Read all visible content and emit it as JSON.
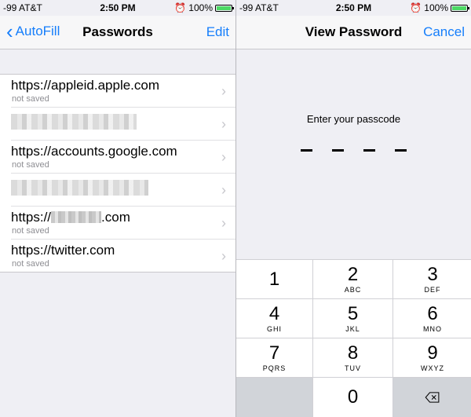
{
  "left": {
    "status": {
      "carrier": "-99 AT&T",
      "time": "2:50 PM",
      "battery": "100%"
    },
    "nav": {
      "back_label": "AutoFill",
      "title": "Passwords",
      "edit_label": "Edit"
    },
    "rows": [
      {
        "title": "https://appleid.apple.com",
        "subtitle": "not saved"
      },
      {
        "title": "",
        "subtitle": ""
      },
      {
        "title": "https://accounts.google.com",
        "subtitle": "not saved"
      },
      {
        "title": "",
        "subtitle": ""
      },
      {
        "title_prefix": "https://",
        "title_suffix": ".com",
        "subtitle": "not saved"
      },
      {
        "title": "https://twitter.com",
        "subtitle": "not saved"
      }
    ]
  },
  "right": {
    "status": {
      "carrier": "-99 AT&T",
      "time": "2:50 PM",
      "battery": "100%"
    },
    "nav": {
      "title": "View Password",
      "cancel_label": "Cancel"
    },
    "prompt": "Enter your passcode",
    "keys": [
      {
        "num": "1",
        "letters": ""
      },
      {
        "num": "2",
        "letters": "ABC"
      },
      {
        "num": "3",
        "letters": "DEF"
      },
      {
        "num": "4",
        "letters": "GHI"
      },
      {
        "num": "5",
        "letters": "JKL"
      },
      {
        "num": "6",
        "letters": "MNO"
      },
      {
        "num": "7",
        "letters": "PQRS"
      },
      {
        "num": "8",
        "letters": "TUV"
      },
      {
        "num": "9",
        "letters": "WXYZ"
      },
      {
        "num": "0",
        "letters": ""
      }
    ]
  },
  "colors": {
    "accent": "#157efb",
    "battery": "#4cd964"
  }
}
